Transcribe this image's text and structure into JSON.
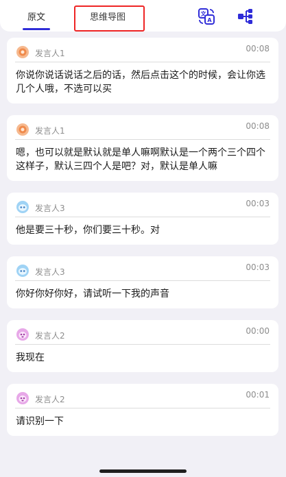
{
  "tabs": {
    "original_label": "原文",
    "mindmap_label": "思维导图"
  },
  "icons": {
    "translate": "translate-icon",
    "tree": "mind-map-tree-icon"
  },
  "colors": {
    "accent": "#2f2cd8",
    "highlight": "#ee2424",
    "background": "#f1f0f6"
  },
  "transcript": [
    {
      "speaker": "发言人1",
      "avatar": "orange-avatar-icon",
      "time": "00:08",
      "text": "你说你说话说话之后的话，然后点击这个的时候，会让你选几个人哦，不选可以买"
    },
    {
      "speaker": "发言人1",
      "avatar": "orange-avatar-icon",
      "time": "00:08",
      "text": "嗯，也可以就是默认就是单人嘛啊默认是一个两个三个四个这样子，默认三四个人是吧？对，默认是单人嘛"
    },
    {
      "speaker": "发言人3",
      "avatar": "blue-avatar-icon",
      "time": "00:03",
      "text": "他是要三十秒，你们要三十秒。对"
    },
    {
      "speaker": "发言人3",
      "avatar": "blue-avatar-icon",
      "time": "00:03",
      "text": "你好你好你好，请试听一下我的声音"
    },
    {
      "speaker": "发言人2",
      "avatar": "purple-avatar-icon",
      "time": "00:00",
      "text": "我现在"
    },
    {
      "speaker": "发言人2",
      "avatar": "purple-avatar-icon",
      "time": "00:01",
      "text": "请识别一下"
    }
  ]
}
